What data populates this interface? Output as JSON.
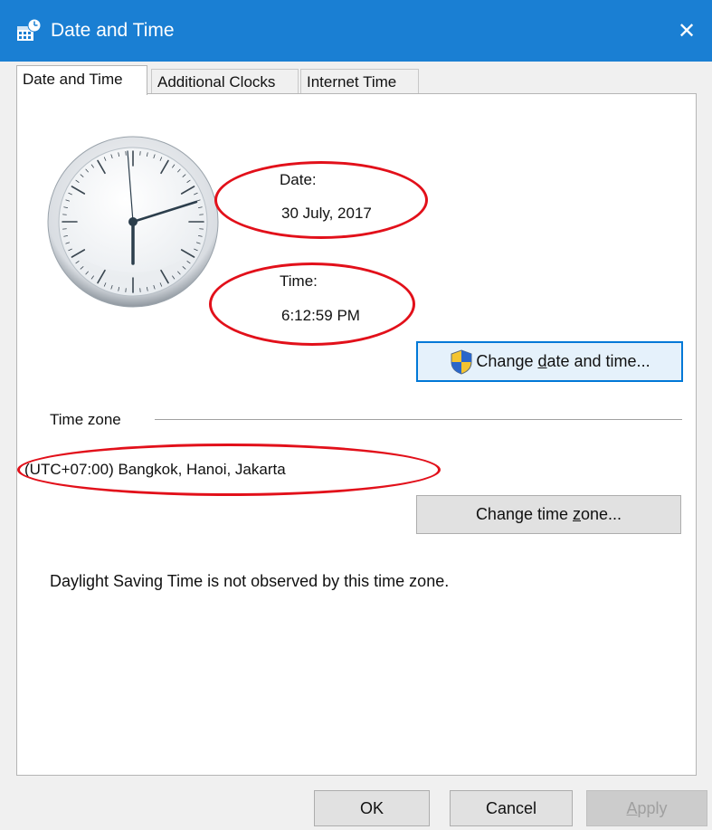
{
  "window": {
    "title": "Date and Time",
    "title_icon": "date-time-control-panel-icon",
    "close_icon": "close-icon",
    "close_glyph": "✕",
    "accent_color": "#1a7fd3"
  },
  "tabs": [
    {
      "label": "Date and Time",
      "active": true
    },
    {
      "label": "Additional Clocks",
      "active": false
    },
    {
      "label": "Internet Time",
      "active": false
    }
  ],
  "date_time": {
    "date_label": "Date:",
    "date_value": "30 July, 2017",
    "time_label": "Time:",
    "time_value": "6:12:59 PM",
    "change_button": {
      "prefix": "Change ",
      "underline": "d",
      "suffix": "ate and time...",
      "icon": "uac-shield-icon"
    }
  },
  "time_zone": {
    "group_label": "Time zone",
    "value": "(UTC+07:00) Bangkok, Hanoi, Jakarta",
    "change_button": {
      "prefix": "Change time ",
      "underline": "z",
      "suffix": "one..."
    },
    "dst_note": "Daylight Saving Time is not observed by this time zone."
  },
  "footer": {
    "ok_label": "OK",
    "cancel_label": "Cancel",
    "apply_underline": "A",
    "apply_rest": "pply",
    "apply_enabled": false
  },
  "annotation_color": "#e2101a"
}
